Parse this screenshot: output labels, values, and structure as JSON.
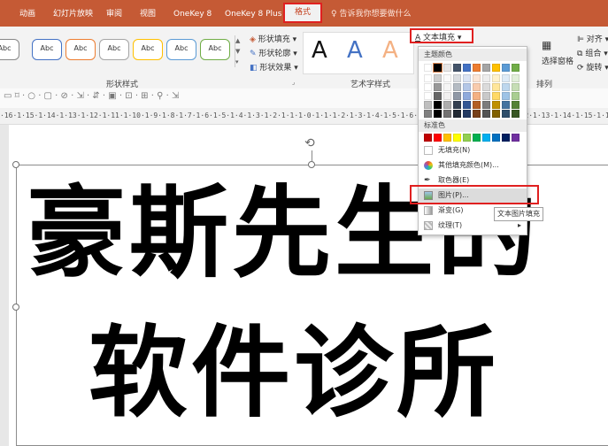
{
  "tabs": [
    "动画",
    "幻灯片放映",
    "审阅",
    "视图",
    "OneKey 8",
    "OneKey 8 Plus"
  ],
  "active_tab": "格式",
  "tell_me": "告诉我你想要做什么",
  "ribbon": {
    "shape_styles_label": "形状样式",
    "shape_style_sample": "Abc",
    "shape_fill": "形状填充",
    "shape_outline": "形状轮廓",
    "shape_effects": "形状效果",
    "wordart_label": "艺术字样式",
    "wordart_letter": "A",
    "text_fill": "文本填充",
    "align": "对齐",
    "group": "组合",
    "rotate": "旋转",
    "selection_pane": "选择窗格",
    "arrange_label": "排列"
  },
  "ruler_text": "·16·1·15·1·14·1·13·1·12·1·11·1·10·1·9·1·8·1·7·1·6·1·5·1·4·1·3·1·2·1·1·1·0·1·1·1·2·1·3·1·4·1·5·1·6·1·7·1·8·1·9·1·10·1·11·1·12·1·13·1·14·1·15·1·16·",
  "slide_text": {
    "line1": "豪斯先生的",
    "line2": "软件诊所"
  },
  "dropdown": {
    "theme_colors_label": "主题颜色",
    "standard_colors_label": "标准色",
    "no_fill": "无填充(N)",
    "more_colors": "其他填充颜色(M)...",
    "eyedropper": "取色器(E)",
    "picture": "图片(P)...",
    "gradient": "渐变(G)",
    "texture": "纹理(T)"
  },
  "tooltip": "文本图片填充",
  "colors": {
    "accent": "#c55a35",
    "highlight": "#e02020",
    "theme_top": [
      "#ffffff",
      "#000000",
      "#e7e6e6",
      "#44546a",
      "#4472c4",
      "#ed7d31",
      "#a5a5a5",
      "#ffc000",
      "#5b9bd5",
      "#70ad47"
    ],
    "standard": [
      "#c00000",
      "#ff0000",
      "#ffc000",
      "#ffff00",
      "#92d050",
      "#00b050",
      "#00b0f0",
      "#0070c0",
      "#002060",
      "#7030a0"
    ]
  }
}
